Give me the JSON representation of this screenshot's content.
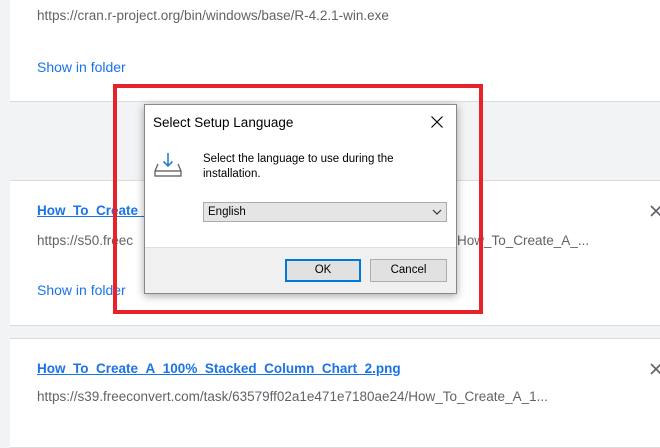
{
  "downloads": [
    {
      "url": "https://cran.r-project.org/bin/windows/base/R-4.2.1-win.exe",
      "action": "Show in folder"
    },
    {
      "filename": "How_To_Create_",
      "url": "https://s50.freec",
      "url_tail": "How_To_Create_A_...",
      "action": "Show in folder"
    },
    {
      "filename": "How_To_Create_A_100%_Stacked_Column_Chart_2.png",
      "url": "https://s39.freeconvert.com/task/63579ff02a1e471e7180ae24/How_To_Create_A_1..."
    }
  ],
  "dialog": {
    "title": "Select Setup Language",
    "prompt": "Select the language to use during the installation.",
    "language_selected": "English",
    "ok_label": "OK",
    "cancel_label": "Cancel"
  },
  "icons": {
    "dialog_icon": "install-download-icon",
    "close": "close-icon",
    "dropdown": "chevron-down-icon"
  },
  "colors": {
    "link": "#1a73e8",
    "highlight": "#e8222b",
    "ok_focus": "#0078d7"
  }
}
